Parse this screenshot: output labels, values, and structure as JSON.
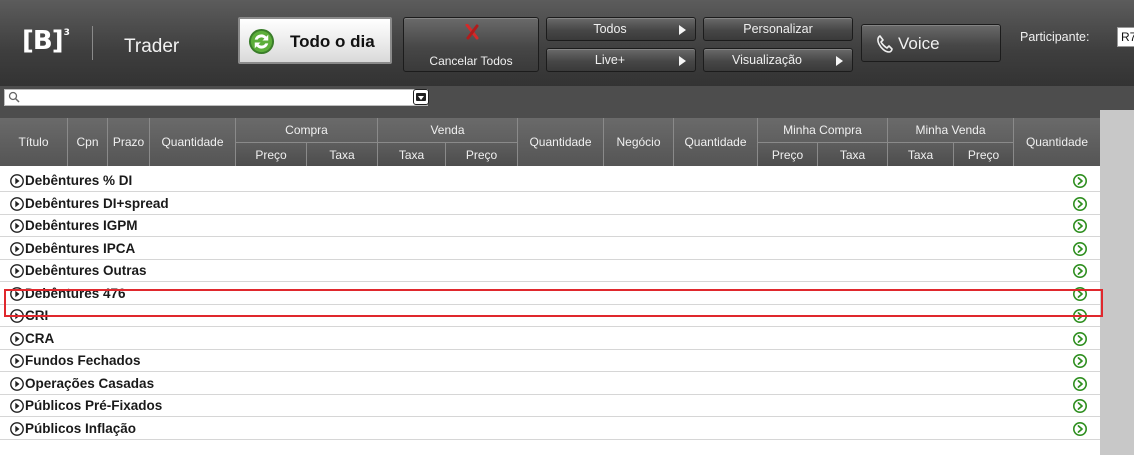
{
  "toolbar": {
    "logo_text": "[B]",
    "logo_sup": "3",
    "app_title": "Trader",
    "todo_dia_label": "Todo o dia",
    "cancel_label": "Cancelar Todos",
    "todos_label": "Todos",
    "live_label": "Live+",
    "personalizar_label": "Personalizar",
    "visualizacao_label": "Visualização",
    "voice_label": "Voice",
    "participante_label": "Participante:",
    "participante_value": "R7"
  },
  "search": {
    "placeholder": ""
  },
  "table": {
    "headers": {
      "titulo": "Título",
      "cpn": "Cpn",
      "prazo": "Prazo",
      "quantidade1": "Quantidade",
      "compra": "Compra",
      "venda": "Venda",
      "quantidade2": "Quantidade",
      "negocio": "Negócio",
      "quantidade3": "Quantidade",
      "minha_compra": "Minha Compra",
      "minha_venda": "Minha Venda",
      "quantidade4": "Quantidade",
      "preco": "Preço",
      "taxa": "Taxa"
    },
    "rows": [
      "Debêntures % DI",
      "Debêntures DI+spread",
      "Debêntures IGPM",
      "Debêntures IPCA",
      "Debêntures Outras",
      "Debêntures 476",
      "CRI",
      "CRA",
      "Fundos Fechados",
      "Operações Casadas",
      "Públicos Pré-Fixados",
      "Públicos Inflação"
    ],
    "highlighted_row": "Debêntures 476"
  },
  "colors": {
    "highlight": "#e0282d",
    "toolbar_bg": "#3e3e3e",
    "header_bg": "#5a5a5a",
    "go_icon": "#2f8f20"
  },
  "icons": {
    "refresh": "refresh-icon",
    "cancel": "cancel-x-icon",
    "phone": "phone-icon",
    "search": "search-icon",
    "expand": "expand-arrow-icon",
    "go": "go-arrow-icon"
  }
}
